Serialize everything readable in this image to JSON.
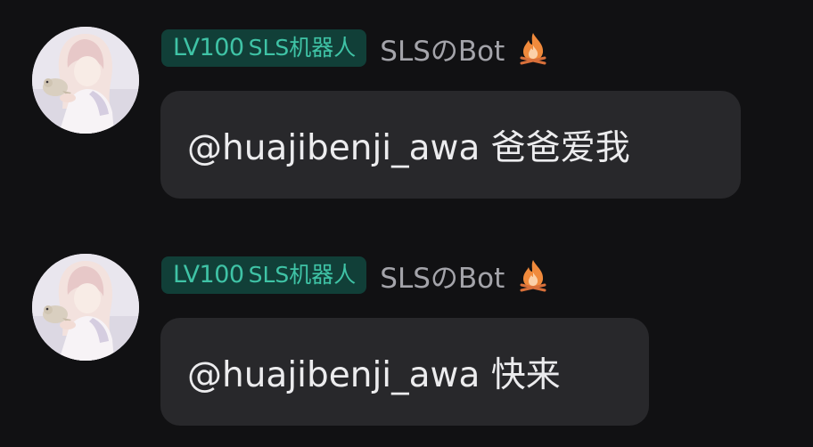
{
  "messages": [
    {
      "sender": {
        "level": "LV100",
        "title": "SLS机器人",
        "name": "SLSのBot",
        "name_icon": "fire-icon",
        "avatar": "anime-girl-holding-bird-avatar"
      },
      "text": "@huajibenji_awa 爸爸爱我"
    },
    {
      "sender": {
        "level": "LV100",
        "title": "SLS机器人",
        "name": "SLSのBot",
        "name_icon": "fire-icon",
        "avatar": "anime-girl-holding-bird-avatar"
      },
      "text": "@huajibenji_awa 快来"
    }
  ],
  "colors": {
    "background": "#111113",
    "bubble": "#28282b",
    "badge_bg": "#113f38",
    "badge_text": "#3fc3a6",
    "name_text": "#a4a4aa",
    "message_text": "#ececee",
    "fire": "#f08a3c"
  }
}
